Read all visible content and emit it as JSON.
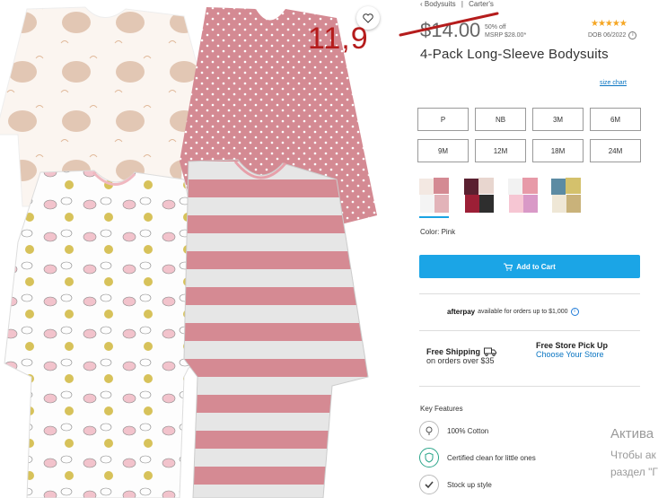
{
  "breadcrumb": {
    "items": [
      "Bodysuits",
      "Carter's"
    ],
    "separator": "|"
  },
  "price": {
    "original": "$14.00",
    "discount": "50% off",
    "msrp": "MSRP $28.00*",
    "annotation": "11,9"
  },
  "rating": {
    "stars": "★★★★★",
    "value": 5,
    "dob": "DOB 06/2022"
  },
  "product": {
    "title": "4-Pack Long-Sleeve Bodysuits",
    "size_chart": "size chart"
  },
  "sizes": [
    "P",
    "NB",
    "3M",
    "6M",
    "9M",
    "12M",
    "18M",
    "24M"
  ],
  "swatches": [
    "pink-elephant",
    "floral-red",
    "pink-multi",
    "neutral-mix"
  ],
  "color": {
    "label": "Color: Pink"
  },
  "cart": {
    "add_label": "Add to Cart"
  },
  "afterpay": {
    "brand": "afterpay",
    "text": "available for orders up to $1,000"
  },
  "shipping": {
    "free_shipping_title": "Free Shipping",
    "free_shipping_sub": "on orders over $35",
    "pickup_title": "Free Store Pick Up",
    "pickup_link": "Choose Your Store"
  },
  "key_features": {
    "title": "Key Features",
    "items": [
      "100% Cotton",
      "Certified clean for little ones",
      "Stock up style"
    ]
  },
  "windows_overlay": {
    "line1": "Актива",
    "line2": "Чтобы ак",
    "line3": "раздел \"Г"
  },
  "colors": {
    "accent": "#1ba5e6",
    "stars": "#f5a623",
    "annotation": "#b51c1c",
    "link": "#0a75c2"
  }
}
